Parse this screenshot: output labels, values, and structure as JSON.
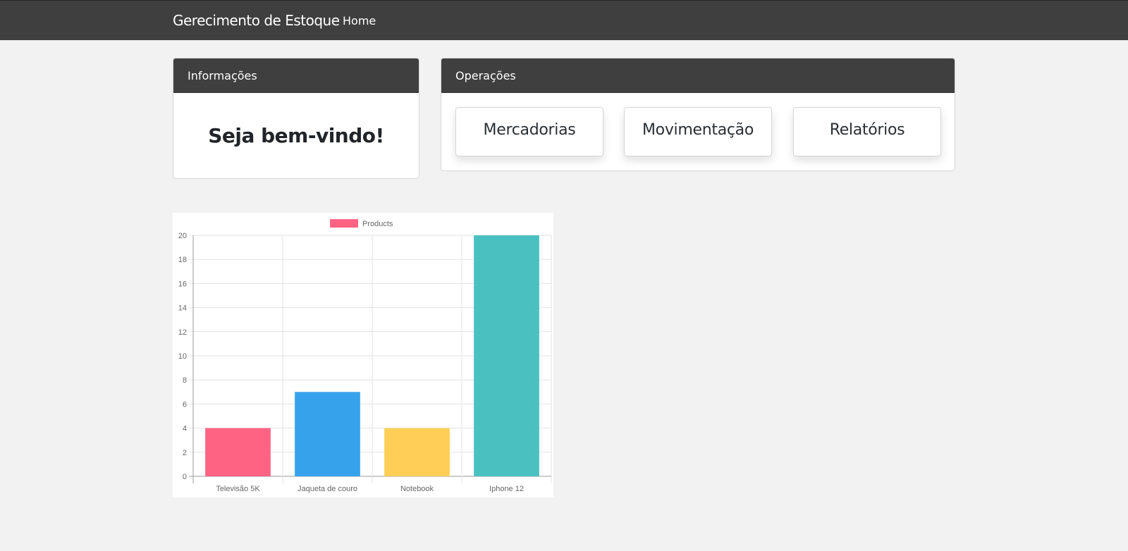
{
  "navbar": {
    "brand": "Gerecimento de Estoque",
    "home": "Home"
  },
  "info_card": {
    "header": "Informações",
    "welcome": "Seja bem-vindo!"
  },
  "operations_card": {
    "header": "Operações",
    "buttons": [
      {
        "label": "Mercadorias"
      },
      {
        "label": "Movimentação"
      },
      {
        "label": "Relatórios"
      }
    ]
  },
  "colors": {
    "navbar": "#3f3f3f",
    "background": "#f2f2f2"
  },
  "chart_data": {
    "type": "bar",
    "categories": [
      "Televisão 5K",
      "Jaqueta de couro",
      "Notebook",
      "Iphone 12"
    ],
    "series": [
      {
        "name": "Products",
        "values": [
          4,
          7,
          4,
          20
        ]
      }
    ],
    "bar_colors": [
      "#ff6384",
      "#36a2eb",
      "#ffce56",
      "#4bc0c0"
    ],
    "legend_color": "#ff6384",
    "ylim": [
      0,
      20
    ],
    "yticks": [
      0,
      2,
      4,
      6,
      8,
      10,
      12,
      14,
      16,
      18,
      20
    ],
    "grid": true,
    "legend": "top"
  }
}
